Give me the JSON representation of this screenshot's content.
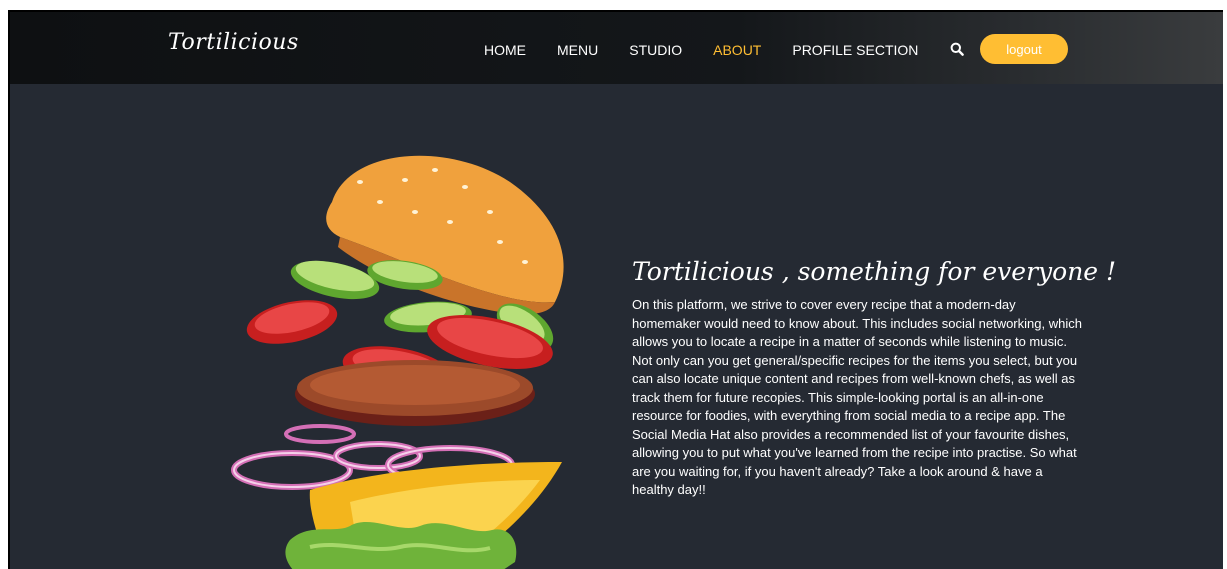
{
  "brand": {
    "name": "Tortilicious"
  },
  "nav": {
    "items": [
      {
        "label": "HOME",
        "active": false
      },
      {
        "label": "MENU",
        "active": false
      },
      {
        "label": "STUDIO",
        "active": false
      },
      {
        "label": "ABOUT",
        "active": true
      },
      {
        "label": "PROFILE SECTION",
        "active": false
      }
    ],
    "search_icon": "search-icon",
    "logout_label": "logout"
  },
  "about": {
    "title": "Tortilicious , something for everyone !",
    "body": "On this platform, we strive to cover every recipe that a modern-day homemaker would need to know about. This includes social networking, which allows you to locate a recipe in a matter of seconds while listening to music. Not only can you get general/specific recipes for the items you select, but you can also locate unique content and recipes from well-known chefs, as well as track them for future recopies. This simple-looking portal is an all-in-one resource for foodies, with everything from social media to a recipe app. The Social Media Hat also provides a recommended list of your favourite dishes, allowing you to put what you've learned from the recipe into practise. So what are you waiting for, if you haven't already? Take a look around & have a healthy day!!"
  },
  "colors": {
    "accent": "#ffbe33",
    "background": "#252a33",
    "navbar": "#0e1012"
  }
}
